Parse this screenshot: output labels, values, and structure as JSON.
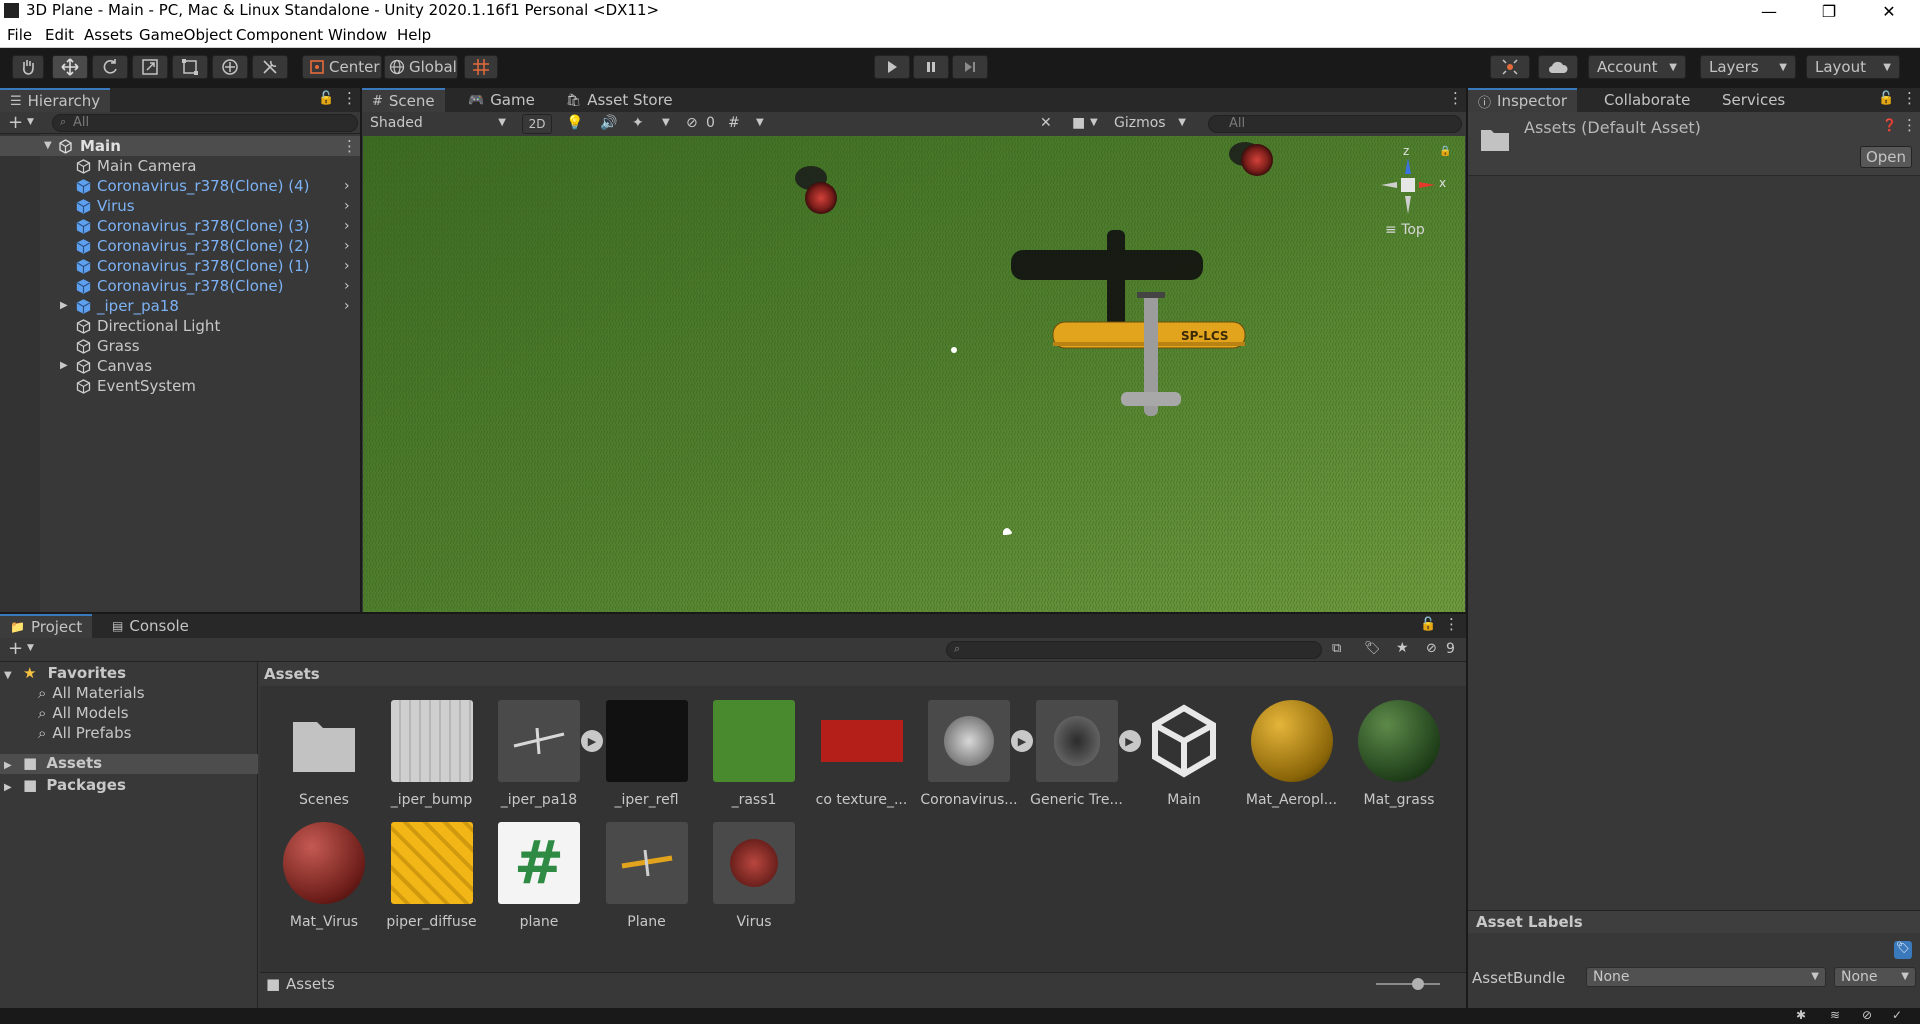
{
  "window": {
    "title": "3D Plane - Main - PC, Mac & Linux Standalone - Unity 2020.1.16f1 Personal <DX11>",
    "minimize": "—",
    "maximize": "❐",
    "close": "✕"
  },
  "menu": [
    "File",
    "Edit",
    "Assets",
    "GameObject",
    "Component",
    "Window",
    "Help"
  ],
  "toolbar": {
    "pivot": "Center",
    "space": "Global",
    "account": "Account",
    "layers": "Layers",
    "layout": "Layout"
  },
  "hierarchy": {
    "tab": "Hierarchy",
    "search_placeholder": "All",
    "scene": "Main",
    "items": [
      {
        "label": "Main Camera",
        "prefab": false
      },
      {
        "label": "Coronavirus_r378(Clone) (4)",
        "prefab": true
      },
      {
        "label": "Virus",
        "prefab": true
      },
      {
        "label": "Coronavirus_r378(Clone) (3)",
        "prefab": true
      },
      {
        "label": "Coronavirus_r378(Clone) (2)",
        "prefab": true
      },
      {
        "label": "Coronavirus_r378(Clone) (1)",
        "prefab": true
      },
      {
        "label": "Coronavirus_r378(Clone)",
        "prefab": true
      },
      {
        "label": "_iper_pa18",
        "prefab": true
      },
      {
        "label": "Directional Light",
        "prefab": false
      },
      {
        "label": "Grass",
        "prefab": false
      },
      {
        "label": "Canvas",
        "prefab": false
      },
      {
        "label": "EventSystem",
        "prefab": false
      }
    ]
  },
  "scene_view": {
    "tabs": [
      "Scene",
      "Game",
      "Asset Store"
    ],
    "shading": "Shaded",
    "mode_2d": "2D",
    "hidden_count": "0",
    "gizmos": "Gizmos",
    "search_placeholder": "All",
    "view_label": "Top",
    "axis_x": "x",
    "axis_z": "z",
    "plane_text": "SP-LCS"
  },
  "inspector": {
    "tabs": [
      "Inspector",
      "Collaborate",
      "Services"
    ],
    "asset_title": "Assets (Default Asset)",
    "open_button": "Open",
    "asset_labels": "Asset Labels",
    "assetbundle_label": "AssetBundle",
    "assetbundle_value": "None",
    "variant_value": "None"
  },
  "project": {
    "tabs": [
      "Project",
      "Console"
    ],
    "hidden_count": "9",
    "favorites_label": "Favorites",
    "favorites": [
      "All Materials",
      "All Models",
      "All Prefabs"
    ],
    "roots": [
      "Assets",
      "Packages"
    ],
    "breadcrumb": "Assets",
    "footer_path": "Assets",
    "assets": [
      "Scenes",
      "_iper_bump",
      "_iper_pa18",
      "_iper_refl",
      "_rass1",
      "co texture_...",
      "Coronavirus...",
      "Generic Tre...",
      "Main",
      "Mat_Aeropl...",
      "Mat_grass",
      "Mat_Virus",
      "piper_diffuse",
      "plane",
      "Plane",
      "Virus"
    ]
  }
}
